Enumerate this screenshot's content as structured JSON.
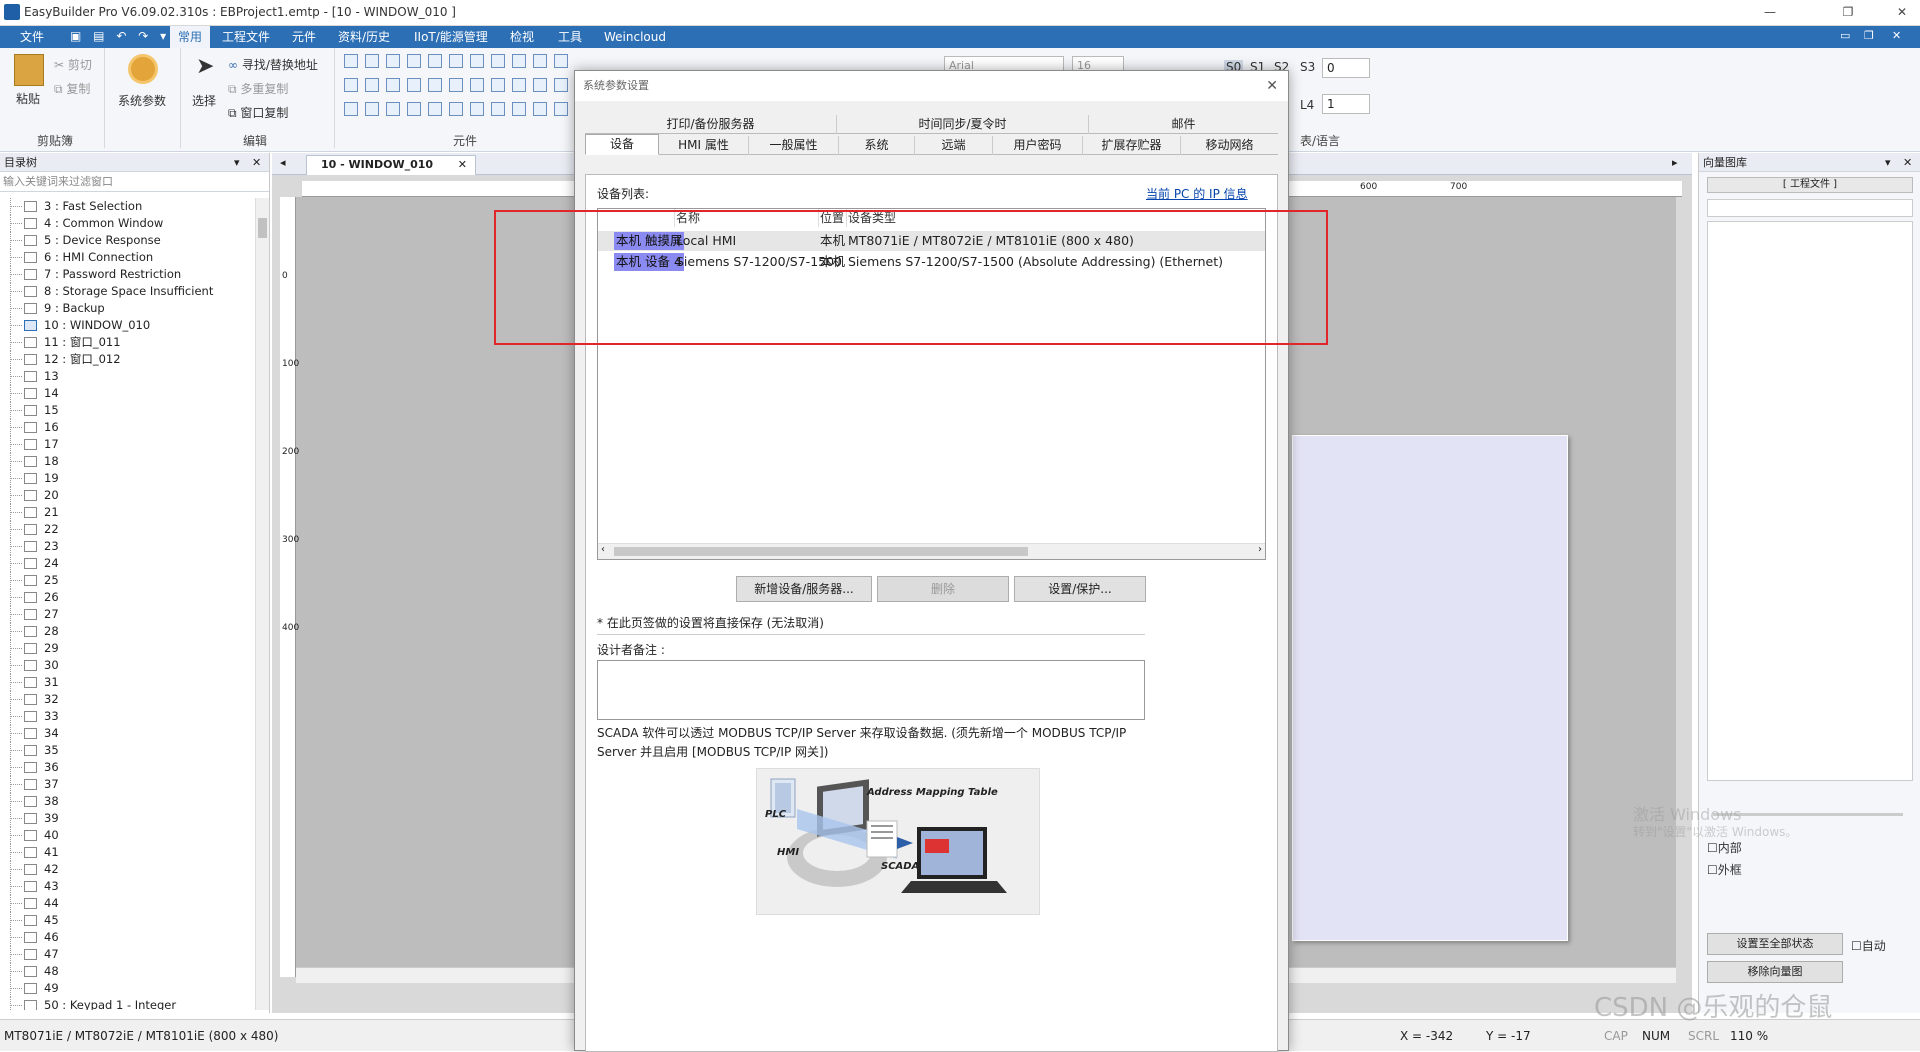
{
  "window": {
    "title": "EasyBuilder Pro V6.09.02.310s : EBProject1.emtp - [10 - WINDOW_010 ]",
    "ctrl_restore": "❐",
    "ctrl_minimize": "—",
    "ctrl_close": "✕"
  },
  "menubar": {
    "items": [
      "文件",
      "常用",
      "工程文件",
      "元件",
      "资料/历史",
      "IIoT/能源管理",
      "检视",
      "工具",
      "Weincloud"
    ],
    "active": "常用"
  },
  "ribbon": {
    "clipboard": {
      "paste": "粘贴",
      "cut": "剪切",
      "copy": "复制",
      "group": "剪贴簿"
    },
    "sysparams": "系统参数",
    "edit": {
      "select": "选择",
      "find_replace": "寻找/替换地址",
      "multi_copy": "多重复制",
      "window_copy": "窗口复制",
      "group": "编辑"
    },
    "objects": {
      "group": "元件"
    },
    "font": {
      "name": "Arial",
      "size": "16"
    },
    "state": {
      "s0": "S0",
      "s1": "S1",
      "s2": "S2",
      "s3": "S3",
      "s3_value": "0",
      "l4": "L4",
      "l4_value": "1"
    },
    "language_group": "表/语言"
  },
  "tree": {
    "title": "目录树",
    "filter_placeholder": "输入关键词来过滤窗口",
    "items": [
      "3 : Fast Selection",
      "4 : Common Window",
      "5 : Device Response",
      "6 : HMI Connection",
      "7 : Password Restriction",
      "8 : Storage Space Insufficient",
      "9 : Backup",
      "10 : WINDOW_010",
      "11 : 窗口_011",
      "12 : 窗口_012",
      "13",
      "14",
      "15",
      "16",
      "17",
      "18",
      "19",
      "20",
      "21",
      "22",
      "23",
      "24",
      "25",
      "26",
      "27",
      "28",
      "29",
      "30",
      "31",
      "32",
      "33",
      "34",
      "35",
      "36",
      "37",
      "38",
      "39",
      "40",
      "41",
      "42",
      "43",
      "44",
      "45",
      "46",
      "47",
      "48",
      "49",
      "50 : Keypad 1 - Integer"
    ]
  },
  "doc": {
    "tab_label": "10 - WINDOW_010",
    "ruler_top": [
      "600",
      "700"
    ],
    "ruler_left": [
      "0",
      "100",
      "200",
      "300",
      "400"
    ]
  },
  "rightpane": {
    "title": "向量图库",
    "combo": "[ 工程文件 ]",
    "chk_inner": "内部",
    "chk_outer": "外框",
    "set_all": "设置至全部状态",
    "auto": "自动",
    "remove": "移除向量图",
    "watermark1": "激活 Windows",
    "watermark2": "转到\"设置\"以激活 Windows。"
  },
  "status": {
    "model": "MT8071iE / MT8072iE / MT8101iE (800 x 480)",
    "x": "X = -342",
    "y": "Y = -17",
    "cap": "CAP",
    "num": "NUM",
    "scrl": "SCRL",
    "zoom": "110 %",
    "csdn": "CSDN @乐观的仓鼠"
  },
  "dialog": {
    "title": "系统参数设置",
    "tabs_row1": [
      "打印/备份服务器",
      "时间同步/夏令时",
      "邮件"
    ],
    "tabs_row2": [
      "设备",
      "HMI 属性",
      "一般属性",
      "系统",
      "远端",
      "用户密码",
      "扩展存贮器",
      "移动网络"
    ],
    "active_tab": "设备",
    "device_list_label": "设备列表:",
    "ip_link": "当前 PC 的 IP 信息",
    "columns": [
      "名称",
      "位置",
      "设备类型"
    ],
    "rows": [
      {
        "tag": "本机 触摸屏",
        "name": "Local HMI",
        "loc": "本机",
        "type": "MT8071iE / MT8072iE / MT8101iE (800 x 480)"
      },
      {
        "tag": "本机 设备 4",
        "name": "Siemens S7-1200/S7-1500",
        "loc": "本机",
        "type": "Siemens S7-1200/S7-1500 (Absolute Addressing) (Ethernet)"
      }
    ],
    "btn_add": "新增设备/服务器...",
    "btn_delete": "删除",
    "btn_settings": "设置/保护...",
    "note_direct_save": "* 在此页签做的设置将直接保存 (无法取消)",
    "designer_note_label": "设计者备注 :",
    "scada_text": "SCADA 软件可以透过 MODBUS TCP/IP Server 来存取设备数据. (须先新增一个 MODBUS TCP/IP Server 并且启用 [MODBUS TCP/IP 网关])",
    "diagram": {
      "title": "Address Mapping Table",
      "plc": "PLC",
      "hmi": "HMI",
      "scada": "SCADA"
    }
  },
  "colors": {
    "menubar": "#2c6fb5",
    "highlight_tag": "#8a8af0",
    "annotation": "#e0262b",
    "link": "#0645ad"
  }
}
